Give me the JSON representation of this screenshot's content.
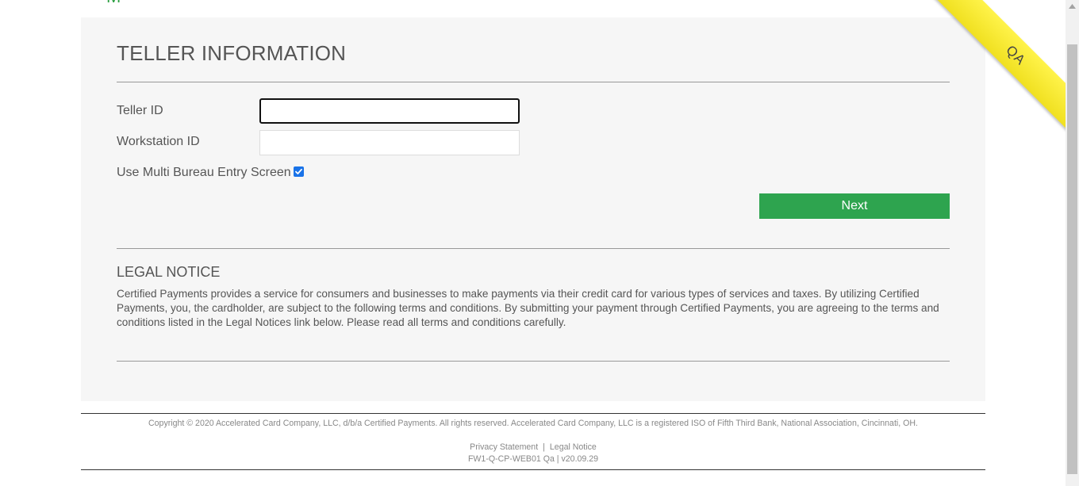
{
  "header": {
    "logo_fragment": "M"
  },
  "teller_form": {
    "title": "TELLER INFORMATION",
    "teller_id_label": "Teller ID",
    "teller_id_value": "",
    "workstation_id_label": "Workstation ID",
    "workstation_id_value": "",
    "multi_bureau_label": "Use Multi Bureau Entry Screen",
    "multi_bureau_checked": true,
    "next_label": "Next"
  },
  "legal": {
    "title": "LEGAL NOTICE",
    "text": "Certified Payments provides a service for consumers and businesses to make payments via their credit card for various types of services and taxes. By utilizing Certified Payments, you, the cardholder, are subject to the following terms and conditions. By submitting your payment through Certified Payments, you are agreeing to the terms and conditions listed in the Legal Notices link below. Please read all terms and conditions carefully."
  },
  "footer": {
    "copyright": "Copyright © 2020 Accelerated Card Company, LLC, d/b/a Certified Payments. All rights reserved. Accelerated Card Company, LLC is a registered ISO of Fifth Third Bank, National Association, Cincinnati, OH.",
    "privacy_link": "Privacy Statement",
    "separator": "|",
    "legal_link": "Legal Notice",
    "build": "FW1-Q-CP-WEB01 Qa | v20.09.29"
  },
  "ribbon": {
    "label": "QA",
    "color": "#f5e930"
  },
  "colors": {
    "accent_green": "#2ea44f",
    "checkbox_blue": "#1a73e8",
    "panel_bg": "#f6f6f6"
  },
  "icons": {
    "checkbox": "checkmark-icon",
    "scroll_up": "chevron-up-icon"
  }
}
